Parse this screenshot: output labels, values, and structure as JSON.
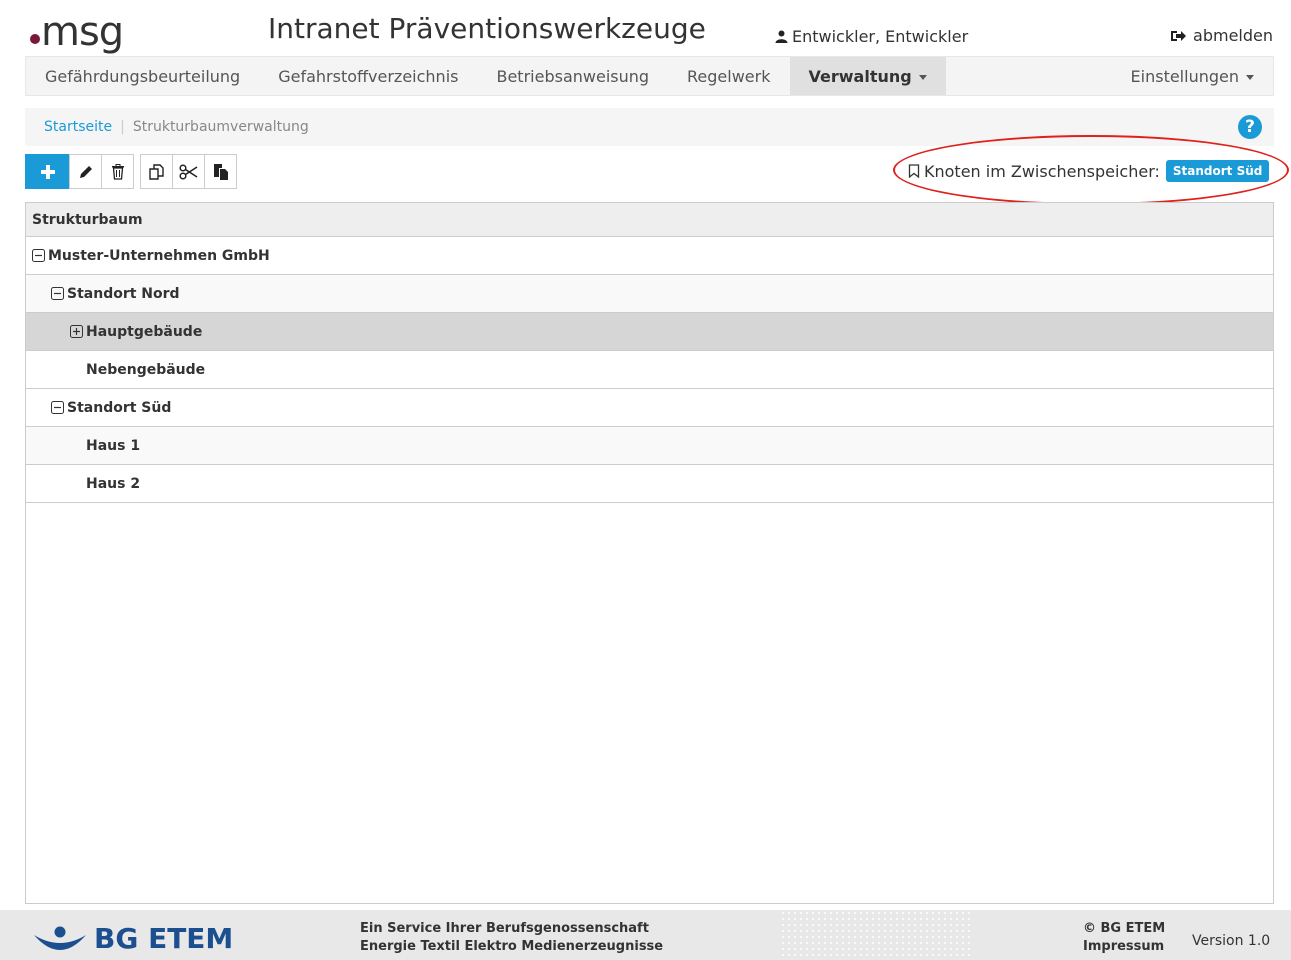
{
  "header": {
    "logo_text": "msg",
    "app_title": "Intranet Präventionswerkzeuge",
    "user_name": "Entwickler, Entwickler",
    "logout_label": "abmelden"
  },
  "nav": {
    "items": [
      {
        "label": "Gefährdungsbeurteilung"
      },
      {
        "label": "Gefahrstoffverzeichnis"
      },
      {
        "label": "Betriebsanweisung"
      },
      {
        "label": "Regelwerk"
      },
      {
        "label": "Verwaltung",
        "active": true
      }
    ],
    "settings_label": "Einstellungen"
  },
  "breadcrumb": {
    "home": "Startseite",
    "current": "Strukturbaumverwaltung",
    "help_icon_text": "?"
  },
  "toolbar": {
    "buttons": [
      "add-icon",
      "edit-icon",
      "delete-icon",
      "copy-icon",
      "cut-icon",
      "paste-icon"
    ]
  },
  "clipboard": {
    "label": "Knoten im Zwischenspeicher:",
    "node": "Standort Süd"
  },
  "tree": {
    "header": "Strukturbaum",
    "rows": [
      {
        "label": "Muster-Unternehmen GmbH",
        "level": 0,
        "toggle": "collapse"
      },
      {
        "label": "Standort Nord",
        "level": 1,
        "toggle": "collapse"
      },
      {
        "label": "Hauptgebäude",
        "level": 2,
        "toggle": "expand",
        "selected": true
      },
      {
        "label": "Nebengebäude",
        "level": 2,
        "toggle": "none"
      },
      {
        "label": "Standort Süd",
        "level": 1,
        "toggle": "collapse"
      },
      {
        "label": "Haus 1",
        "level": 2,
        "toggle": "none"
      },
      {
        "label": "Haus 2",
        "level": 2,
        "toggle": "none"
      }
    ]
  },
  "footer": {
    "brand": "BG ETEM",
    "service_line1": "Ein Service Ihrer Berufsgenossenschaft",
    "service_line2": "Energie Textil Elektro Medienerzeugnisse",
    "copyright": "© BG ETEM",
    "imprint": "Impressum",
    "version": "Version 1.0"
  },
  "colors": {
    "accent": "#1a9bd7",
    "logo_dot": "#7a1838",
    "brand_blue": "#1b4f8f",
    "annotation": "#e0201a"
  }
}
